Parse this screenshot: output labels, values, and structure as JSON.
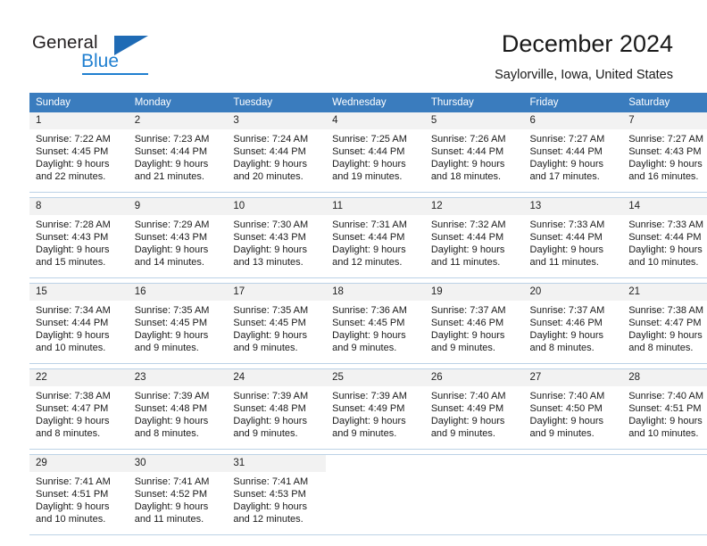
{
  "brand": {
    "name_part1": "General",
    "name_part2": "Blue",
    "triangle_color": "#1f6bb5",
    "blue_color": "#1f7fd0"
  },
  "header": {
    "title": "December 2024",
    "subtitle": "Saylorville, Iowa, United States",
    "header_bg": "#3a7cbe",
    "daynum_bg": "#f2f2f2"
  },
  "calendar": {
    "weekday_headers": [
      "Sunday",
      "Monday",
      "Tuesday",
      "Wednesday",
      "Thursday",
      "Friday",
      "Saturday"
    ],
    "weeks": [
      [
        {
          "day": "1",
          "sunrise": "Sunrise: 7:22 AM",
          "sunset": "Sunset: 4:45 PM",
          "daylight_line1": "Daylight: 9 hours",
          "daylight_line2": "and 22 minutes."
        },
        {
          "day": "2",
          "sunrise": "Sunrise: 7:23 AM",
          "sunset": "Sunset: 4:44 PM",
          "daylight_line1": "Daylight: 9 hours",
          "daylight_line2": "and 21 minutes."
        },
        {
          "day": "3",
          "sunrise": "Sunrise: 7:24 AM",
          "sunset": "Sunset: 4:44 PM",
          "daylight_line1": "Daylight: 9 hours",
          "daylight_line2": "and 20 minutes."
        },
        {
          "day": "4",
          "sunrise": "Sunrise: 7:25 AM",
          "sunset": "Sunset: 4:44 PM",
          "daylight_line1": "Daylight: 9 hours",
          "daylight_line2": "and 19 minutes."
        },
        {
          "day": "5",
          "sunrise": "Sunrise: 7:26 AM",
          "sunset": "Sunset: 4:44 PM",
          "daylight_line1": "Daylight: 9 hours",
          "daylight_line2": "and 18 minutes."
        },
        {
          "day": "6",
          "sunrise": "Sunrise: 7:27 AM",
          "sunset": "Sunset: 4:44 PM",
          "daylight_line1": "Daylight: 9 hours",
          "daylight_line2": "and 17 minutes."
        },
        {
          "day": "7",
          "sunrise": "Sunrise: 7:27 AM",
          "sunset": "Sunset: 4:43 PM",
          "daylight_line1": "Daylight: 9 hours",
          "daylight_line2": "and 16 minutes."
        }
      ],
      [
        {
          "day": "8",
          "sunrise": "Sunrise: 7:28 AM",
          "sunset": "Sunset: 4:43 PM",
          "daylight_line1": "Daylight: 9 hours",
          "daylight_line2": "and 15 minutes."
        },
        {
          "day": "9",
          "sunrise": "Sunrise: 7:29 AM",
          "sunset": "Sunset: 4:43 PM",
          "daylight_line1": "Daylight: 9 hours",
          "daylight_line2": "and 14 minutes."
        },
        {
          "day": "10",
          "sunrise": "Sunrise: 7:30 AM",
          "sunset": "Sunset: 4:43 PM",
          "daylight_line1": "Daylight: 9 hours",
          "daylight_line2": "and 13 minutes."
        },
        {
          "day": "11",
          "sunrise": "Sunrise: 7:31 AM",
          "sunset": "Sunset: 4:44 PM",
          "daylight_line1": "Daylight: 9 hours",
          "daylight_line2": "and 12 minutes."
        },
        {
          "day": "12",
          "sunrise": "Sunrise: 7:32 AM",
          "sunset": "Sunset: 4:44 PM",
          "daylight_line1": "Daylight: 9 hours",
          "daylight_line2": "and 11 minutes."
        },
        {
          "day": "13",
          "sunrise": "Sunrise: 7:33 AM",
          "sunset": "Sunset: 4:44 PM",
          "daylight_line1": "Daylight: 9 hours",
          "daylight_line2": "and 11 minutes."
        },
        {
          "day": "14",
          "sunrise": "Sunrise: 7:33 AM",
          "sunset": "Sunset: 4:44 PM",
          "daylight_line1": "Daylight: 9 hours",
          "daylight_line2": "and 10 minutes."
        }
      ],
      [
        {
          "day": "15",
          "sunrise": "Sunrise: 7:34 AM",
          "sunset": "Sunset: 4:44 PM",
          "daylight_line1": "Daylight: 9 hours",
          "daylight_line2": "and 10 minutes."
        },
        {
          "day": "16",
          "sunrise": "Sunrise: 7:35 AM",
          "sunset": "Sunset: 4:45 PM",
          "daylight_line1": "Daylight: 9 hours",
          "daylight_line2": "and 9 minutes."
        },
        {
          "day": "17",
          "sunrise": "Sunrise: 7:35 AM",
          "sunset": "Sunset: 4:45 PM",
          "daylight_line1": "Daylight: 9 hours",
          "daylight_line2": "and 9 minutes."
        },
        {
          "day": "18",
          "sunrise": "Sunrise: 7:36 AM",
          "sunset": "Sunset: 4:45 PM",
          "daylight_line1": "Daylight: 9 hours",
          "daylight_line2": "and 9 minutes."
        },
        {
          "day": "19",
          "sunrise": "Sunrise: 7:37 AM",
          "sunset": "Sunset: 4:46 PM",
          "daylight_line1": "Daylight: 9 hours",
          "daylight_line2": "and 9 minutes."
        },
        {
          "day": "20",
          "sunrise": "Sunrise: 7:37 AM",
          "sunset": "Sunset: 4:46 PM",
          "daylight_line1": "Daylight: 9 hours",
          "daylight_line2": "and 8 minutes."
        },
        {
          "day": "21",
          "sunrise": "Sunrise: 7:38 AM",
          "sunset": "Sunset: 4:47 PM",
          "daylight_line1": "Daylight: 9 hours",
          "daylight_line2": "and 8 minutes."
        }
      ],
      [
        {
          "day": "22",
          "sunrise": "Sunrise: 7:38 AM",
          "sunset": "Sunset: 4:47 PM",
          "daylight_line1": "Daylight: 9 hours",
          "daylight_line2": "and 8 minutes."
        },
        {
          "day": "23",
          "sunrise": "Sunrise: 7:39 AM",
          "sunset": "Sunset: 4:48 PM",
          "daylight_line1": "Daylight: 9 hours",
          "daylight_line2": "and 8 minutes."
        },
        {
          "day": "24",
          "sunrise": "Sunrise: 7:39 AM",
          "sunset": "Sunset: 4:48 PM",
          "daylight_line1": "Daylight: 9 hours",
          "daylight_line2": "and 9 minutes."
        },
        {
          "day": "25",
          "sunrise": "Sunrise: 7:39 AM",
          "sunset": "Sunset: 4:49 PM",
          "daylight_line1": "Daylight: 9 hours",
          "daylight_line2": "and 9 minutes."
        },
        {
          "day": "26",
          "sunrise": "Sunrise: 7:40 AM",
          "sunset": "Sunset: 4:49 PM",
          "daylight_line1": "Daylight: 9 hours",
          "daylight_line2": "and 9 minutes."
        },
        {
          "day": "27",
          "sunrise": "Sunrise: 7:40 AM",
          "sunset": "Sunset: 4:50 PM",
          "daylight_line1": "Daylight: 9 hours",
          "daylight_line2": "and 9 minutes."
        },
        {
          "day": "28",
          "sunrise": "Sunrise: 7:40 AM",
          "sunset": "Sunset: 4:51 PM",
          "daylight_line1": "Daylight: 9 hours",
          "daylight_line2": "and 10 minutes."
        }
      ],
      [
        {
          "day": "29",
          "sunrise": "Sunrise: 7:41 AM",
          "sunset": "Sunset: 4:51 PM",
          "daylight_line1": "Daylight: 9 hours",
          "daylight_line2": "and 10 minutes."
        },
        {
          "day": "30",
          "sunrise": "Sunrise: 7:41 AM",
          "sunset": "Sunset: 4:52 PM",
          "daylight_line1": "Daylight: 9 hours",
          "daylight_line2": "and 11 minutes."
        },
        {
          "day": "31",
          "sunrise": "Sunrise: 7:41 AM",
          "sunset": "Sunset: 4:53 PM",
          "daylight_line1": "Daylight: 9 hours",
          "daylight_line2": "and 12 minutes."
        },
        {
          "day": "",
          "sunrise": "",
          "sunset": "",
          "daylight_line1": "",
          "daylight_line2": ""
        },
        {
          "day": "",
          "sunrise": "",
          "sunset": "",
          "daylight_line1": "",
          "daylight_line2": ""
        },
        {
          "day": "",
          "sunrise": "",
          "sunset": "",
          "daylight_line1": "",
          "daylight_line2": ""
        },
        {
          "day": "",
          "sunrise": "",
          "sunset": "",
          "daylight_line1": "",
          "daylight_line2": ""
        }
      ]
    ]
  }
}
